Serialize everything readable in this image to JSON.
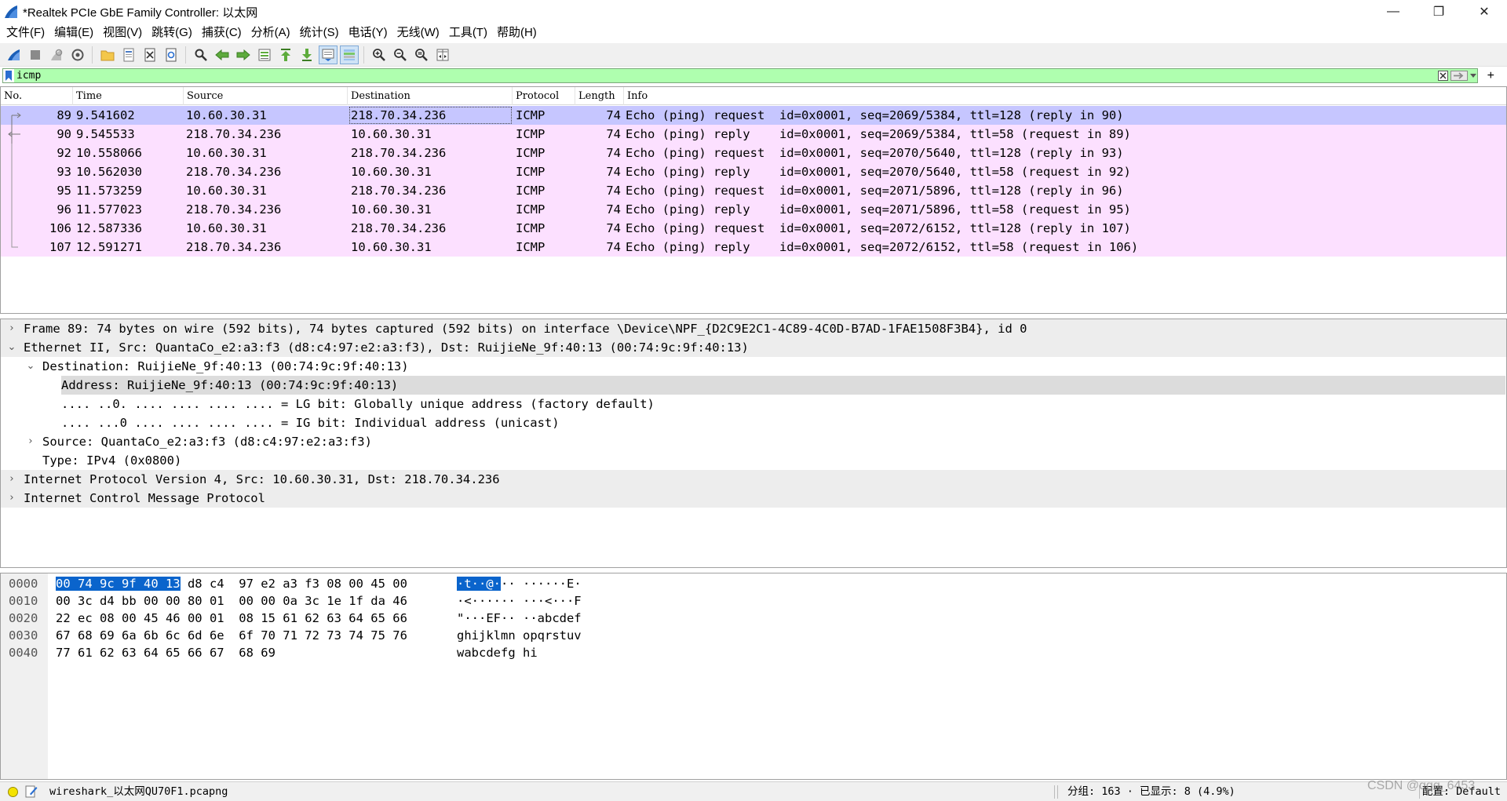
{
  "window": {
    "title": "*Realtek PCIe GbE Family Controller: 以太网",
    "minimize": "—",
    "restore": "❐",
    "close": "✕"
  },
  "menu": [
    "文件(F)",
    "编辑(E)",
    "视图(V)",
    "跳转(G)",
    "捕获(C)",
    "分析(A)",
    "统计(S)",
    "电话(Y)",
    "无线(W)",
    "工具(T)",
    "帮助(H)"
  ],
  "toolbar": {
    "icons": [
      "shark-start-icon",
      "stop-icon",
      "restart-icon",
      "capture-options-icon",
      "open-folder-icon",
      "open-recent-icon",
      "close-file-icon",
      "reload-icon",
      "find-icon",
      "go-back-icon",
      "go-forward-icon",
      "go-to-packet-icon",
      "first-packet-icon",
      "last-packet-icon",
      "autoscroll-icon",
      "colorize-icon",
      "zoom-in-icon",
      "zoom-out-icon",
      "normal-size-icon",
      "resize-columns-icon"
    ]
  },
  "filter": {
    "value": "icmp",
    "clear_icon": "clear-icon",
    "apply_icon": "apply-arrow-icon",
    "dropdown_icon": "chevron-down-icon",
    "add_label": "+"
  },
  "packet_list": {
    "columns": [
      "No.",
      "Time",
      "Source",
      "Destination",
      "Protocol",
      "Length",
      "Info"
    ],
    "rows": [
      {
        "no": "89",
        "time": "9.541602",
        "src": "10.60.30.31",
        "dst": "218.70.34.236",
        "proto": "ICMP",
        "len": "74",
        "info": "Echo (ping) request  id=0x0001, seq=2069/5384, ttl=128 (reply in 90)"
      },
      {
        "no": "90",
        "time": "9.545533",
        "src": "218.70.34.236",
        "dst": "10.60.30.31",
        "proto": "ICMP",
        "len": "74",
        "info": "Echo (ping) reply    id=0x0001, seq=2069/5384, ttl=58 (request in 89)"
      },
      {
        "no": "92",
        "time": "10.558066",
        "src": "10.60.30.31",
        "dst": "218.70.34.236",
        "proto": "ICMP",
        "len": "74",
        "info": "Echo (ping) request  id=0x0001, seq=2070/5640, ttl=128 (reply in 93)"
      },
      {
        "no": "93",
        "time": "10.562030",
        "src": "218.70.34.236",
        "dst": "10.60.30.31",
        "proto": "ICMP",
        "len": "74",
        "info": "Echo (ping) reply    id=0x0001, seq=2070/5640, ttl=58 (request in 92)"
      },
      {
        "no": "95",
        "time": "11.573259",
        "src": "10.60.30.31",
        "dst": "218.70.34.236",
        "proto": "ICMP",
        "len": "74",
        "info": "Echo (ping) request  id=0x0001, seq=2071/5896, ttl=128 (reply in 96)"
      },
      {
        "no": "96",
        "time": "11.577023",
        "src": "218.70.34.236",
        "dst": "10.60.30.31",
        "proto": "ICMP",
        "len": "74",
        "info": "Echo (ping) reply    id=0x0001, seq=2071/5896, ttl=58 (request in 95)"
      },
      {
        "no": "106",
        "time": "12.587336",
        "src": "10.60.30.31",
        "dst": "218.70.34.236",
        "proto": "ICMP",
        "len": "74",
        "info": "Echo (ping) request  id=0x0001, seq=2072/6152, ttl=128 (reply in 107)"
      },
      {
        "no": "107",
        "time": "12.591271",
        "src": "218.70.34.236",
        "dst": "10.60.30.31",
        "proto": "ICMP",
        "len": "74",
        "info": "Echo (ping) reply    id=0x0001, seq=2072/6152, ttl=58 (request in 106)"
      }
    ],
    "selected_index": 0,
    "row_color": "#fce0ff",
    "selected_color": "#c6c6ff"
  },
  "details": [
    {
      "arrow": ">",
      "text": "Frame 89: 74 bytes on wire (592 bits), 74 bytes captured (592 bits) on interface \\Device\\NPF_{D2C9E2C1-4C89-4C0D-B7AD-1FAE1508F3B4}, id 0"
    },
    {
      "arrow": "v",
      "text": "Ethernet II, Src: QuantaCo_e2:a3:f3 (d8:c4:97:e2:a3:f3), Dst: RuijieNe_9f:40:13 (00:74:9c:9f:40:13)"
    },
    {
      "arrow": "v",
      "text": "Destination: RuijieNe_9f:40:13 (00:74:9c:9f:40:13)"
    },
    {
      "arrow": "",
      "text": "Address: RuijieNe_9f:40:13 (00:74:9c:9f:40:13)"
    },
    {
      "arrow": "",
      "text": ".... ..0. .... .... .... .... = LG bit: Globally unique address (factory default)"
    },
    {
      "arrow": "",
      "text": ".... ...0 .... .... .... .... = IG bit: Individual address (unicast)"
    },
    {
      "arrow": ">",
      "text": "Source: QuantaCo_e2:a3:f3 (d8:c4:97:e2:a3:f3)"
    },
    {
      "arrow": "",
      "text": "Type: IPv4 (0x0800)"
    },
    {
      "arrow": ">",
      "text": "Internet Protocol Version 4, Src: 10.60.30.31, Dst: 218.70.34.236"
    },
    {
      "arrow": ">",
      "text": "Internet Control Message Protocol"
    }
  ],
  "bytes": [
    {
      "offset": "0000",
      "hex_sel": "00 74 9c 9f 40 13",
      "hex_rest": " d8 c4  97 e2 a3 f3 08 00 45 00",
      "ascii_sel": "·t··@·",
      "ascii_rest": "·· ······E·"
    },
    {
      "offset": "0010",
      "hex_sel": "",
      "hex_rest": "00 3c d4 bb 00 00 80 01  00 00 0a 3c 1e 1f da 46",
      "ascii_sel": "",
      "ascii_rest": "·<······ ···<···F"
    },
    {
      "offset": "0020",
      "hex_sel": "",
      "hex_rest": "22 ec 08 00 45 46 00 01  08 15 61 62 63 64 65 66",
      "ascii_sel": "",
      "ascii_rest": "\"···EF·· ··abcdef"
    },
    {
      "offset": "0030",
      "hex_sel": "",
      "hex_rest": "67 68 69 6a 6b 6c 6d 6e  6f 70 71 72 73 74 75 76",
      "ascii_sel": "",
      "ascii_rest": "ghijklmn opqrstuv"
    },
    {
      "offset": "0040",
      "hex_sel": "",
      "hex_rest": "77 61 62 63 64 65 66 67  68 69",
      "ascii_sel": "",
      "ascii_rest": "wabcdefg hi"
    }
  ],
  "status": {
    "file": "wireshark_以太网QU70F1.pcapng",
    "stats": "分组: 163 · 已显示: 8 (4.9%)",
    "profile": "配置: Default",
    "watermark": "CSDN @qqq_6453",
    "indicator_color": "#f4e300"
  }
}
